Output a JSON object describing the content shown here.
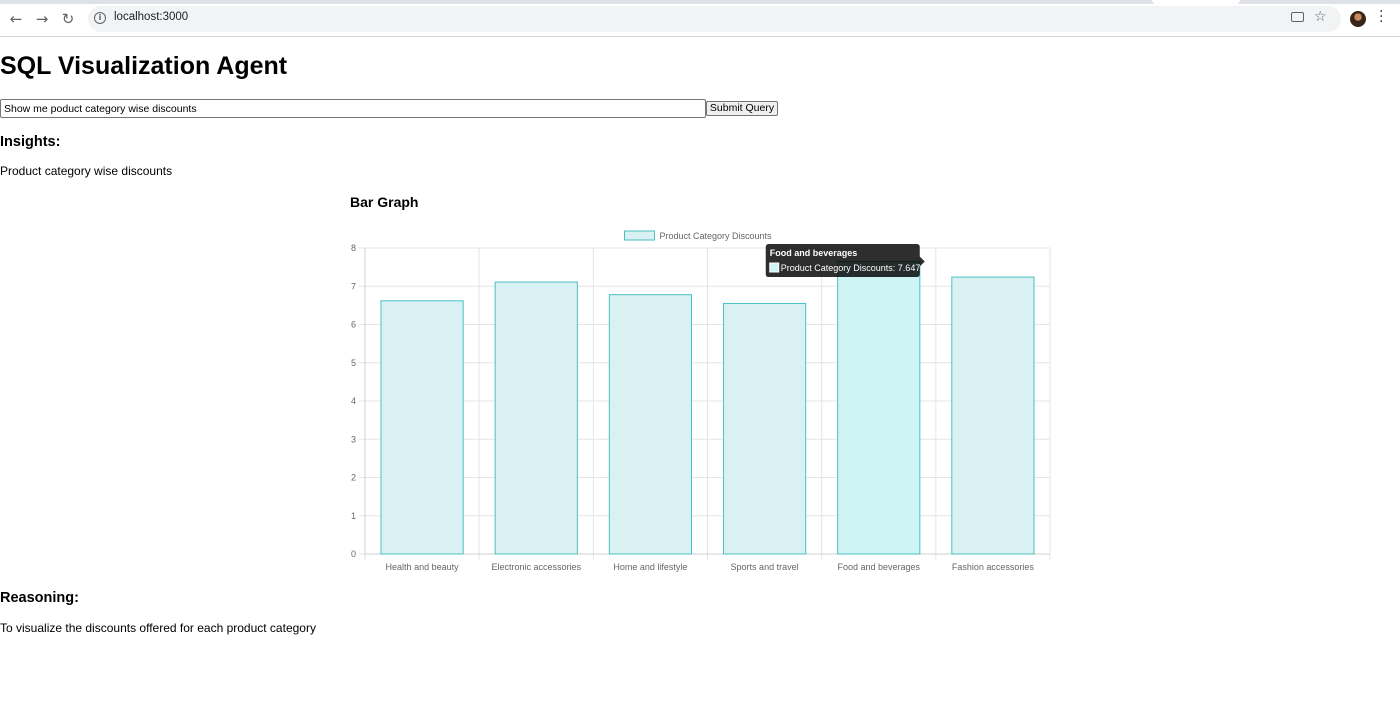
{
  "browser": {
    "url": "localhost:3000"
  },
  "app": {
    "title": "SQL Visualization Agent",
    "query_value": "Show me poduct category wise discounts",
    "submit_label": "Submit Query"
  },
  "insights": {
    "heading": "Insights:",
    "text": "Product category wise discounts"
  },
  "chart_section": {
    "heading": "Bar Graph"
  },
  "reasoning": {
    "heading": "Reasoning:",
    "text": "To visualize the discounts offered for each product category"
  },
  "chart_data": {
    "type": "bar",
    "categories": [
      "Health and beauty",
      "Electronic accessories",
      "Home and lifestyle",
      "Sports and travel",
      "Food and beverages",
      "Fashion accessories"
    ],
    "series": [
      {
        "name": "Product Category Discounts",
        "values": [
          6.62,
          7.11,
          6.78,
          6.55,
          7.647,
          7.24
        ]
      }
    ],
    "ylim": [
      0,
      8
    ],
    "yticks": [
      0,
      1,
      2,
      3,
      4,
      5,
      6,
      7,
      8
    ],
    "grid": true,
    "legend": "top-center",
    "colors": {
      "bar_fill": "#d9f1f2",
      "bar_fill_hover": "#cef4f5",
      "bar_border": "#4bc0c0",
      "grid": "#e5e5e5",
      "tick_text": "#666666"
    },
    "tooltip": {
      "title": "Food and beverages",
      "label": "Product Category Discounts: 7.647",
      "category_index": 4
    }
  }
}
